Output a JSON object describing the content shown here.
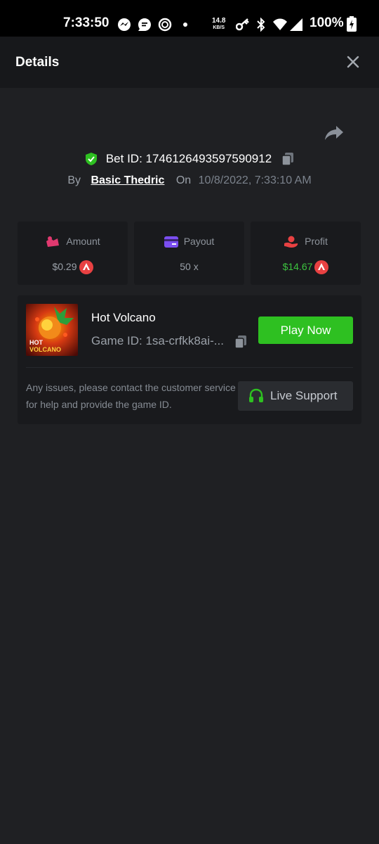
{
  "status_bar": {
    "time": "7:33:50",
    "net_speed": "14.8",
    "net_unit": "KB/S",
    "battery": "100%",
    "icons": [
      "messenger-icon",
      "chat-icon",
      "app-icon",
      "dot-icon",
      "key-icon",
      "bluetooth-icon",
      "wifi-icon",
      "signal-icon",
      "battery-charging-icon"
    ]
  },
  "header": {
    "title": "Details",
    "close_icon": "close-icon"
  },
  "bet": {
    "id_label": "Bet ID: 1746126493597590912",
    "by_label": "By",
    "user": "Basic Thedric",
    "on_label": "On",
    "date": "10/8/2022, 7:33:10 AM"
  },
  "stats": {
    "amount": {
      "label": "Amount",
      "value": "$0.29"
    },
    "payout": {
      "label": "Payout",
      "value": "50 x"
    },
    "profit": {
      "label": "Profit",
      "value": "$14.67"
    }
  },
  "game": {
    "name": "Hot Volcano",
    "id_label": "Game ID: 1sa-crfkk8ai-...",
    "play_label": "Play Now",
    "thumb_text_top": "HOT",
    "thumb_text_bottom": "VOLCANO"
  },
  "support": {
    "help_text": "Any issues, please contact the customer service for help and provide the game ID.",
    "button_label": "Live Support"
  },
  "colors": {
    "background": "#1f2023",
    "header_bg": "#17181b",
    "card_bg": "#191a1d",
    "accent_green": "#2ec021",
    "profit_green": "#3cc33f",
    "avax_red": "#e84142"
  }
}
